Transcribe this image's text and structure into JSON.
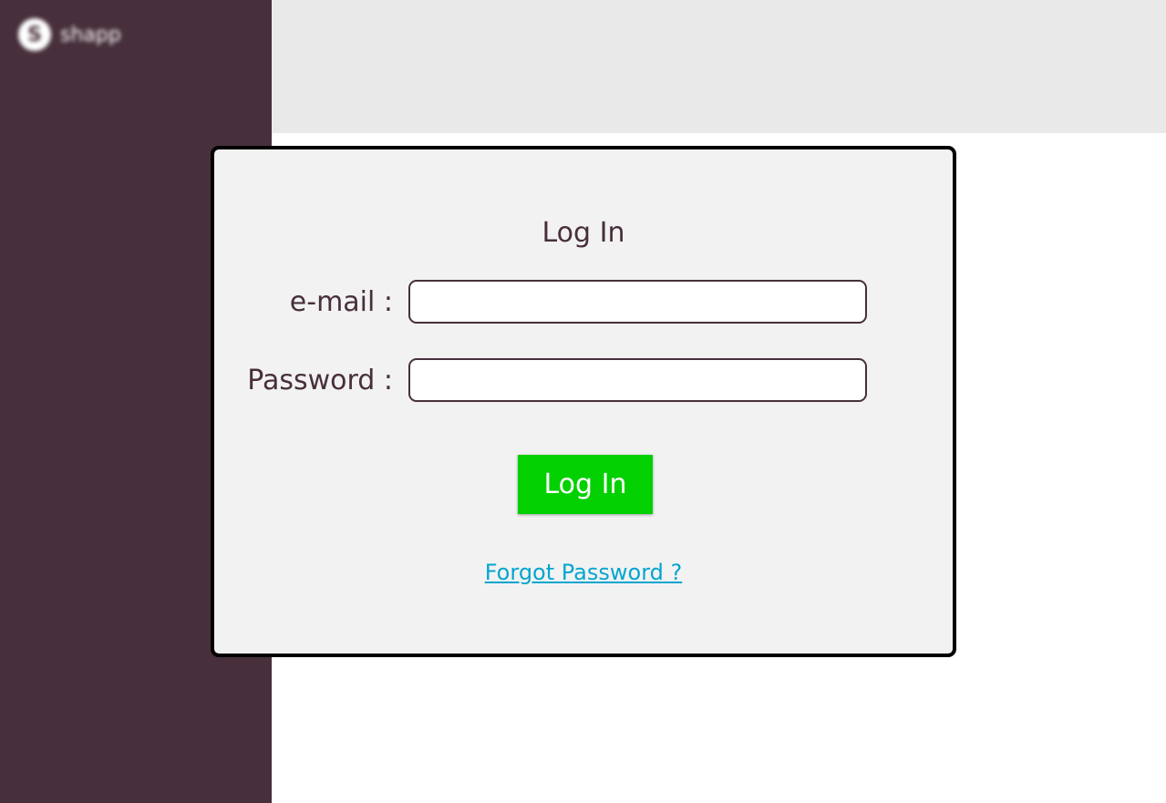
{
  "brand": {
    "logo_letter": "S",
    "name": "shapp"
  },
  "login": {
    "title": "Log In",
    "email_label": "e-mail :",
    "email_value": "",
    "password_label": "Password :",
    "password_value": "",
    "submit_label": "Log In",
    "forgot_label": "Forgot Password ?"
  },
  "colors": {
    "sidebar": "#472f3b",
    "topbar": "#e9e9e9",
    "dialog": "#f2f2f2",
    "text": "#472f3b",
    "button": "#03d000",
    "link": "#04a5cf"
  }
}
